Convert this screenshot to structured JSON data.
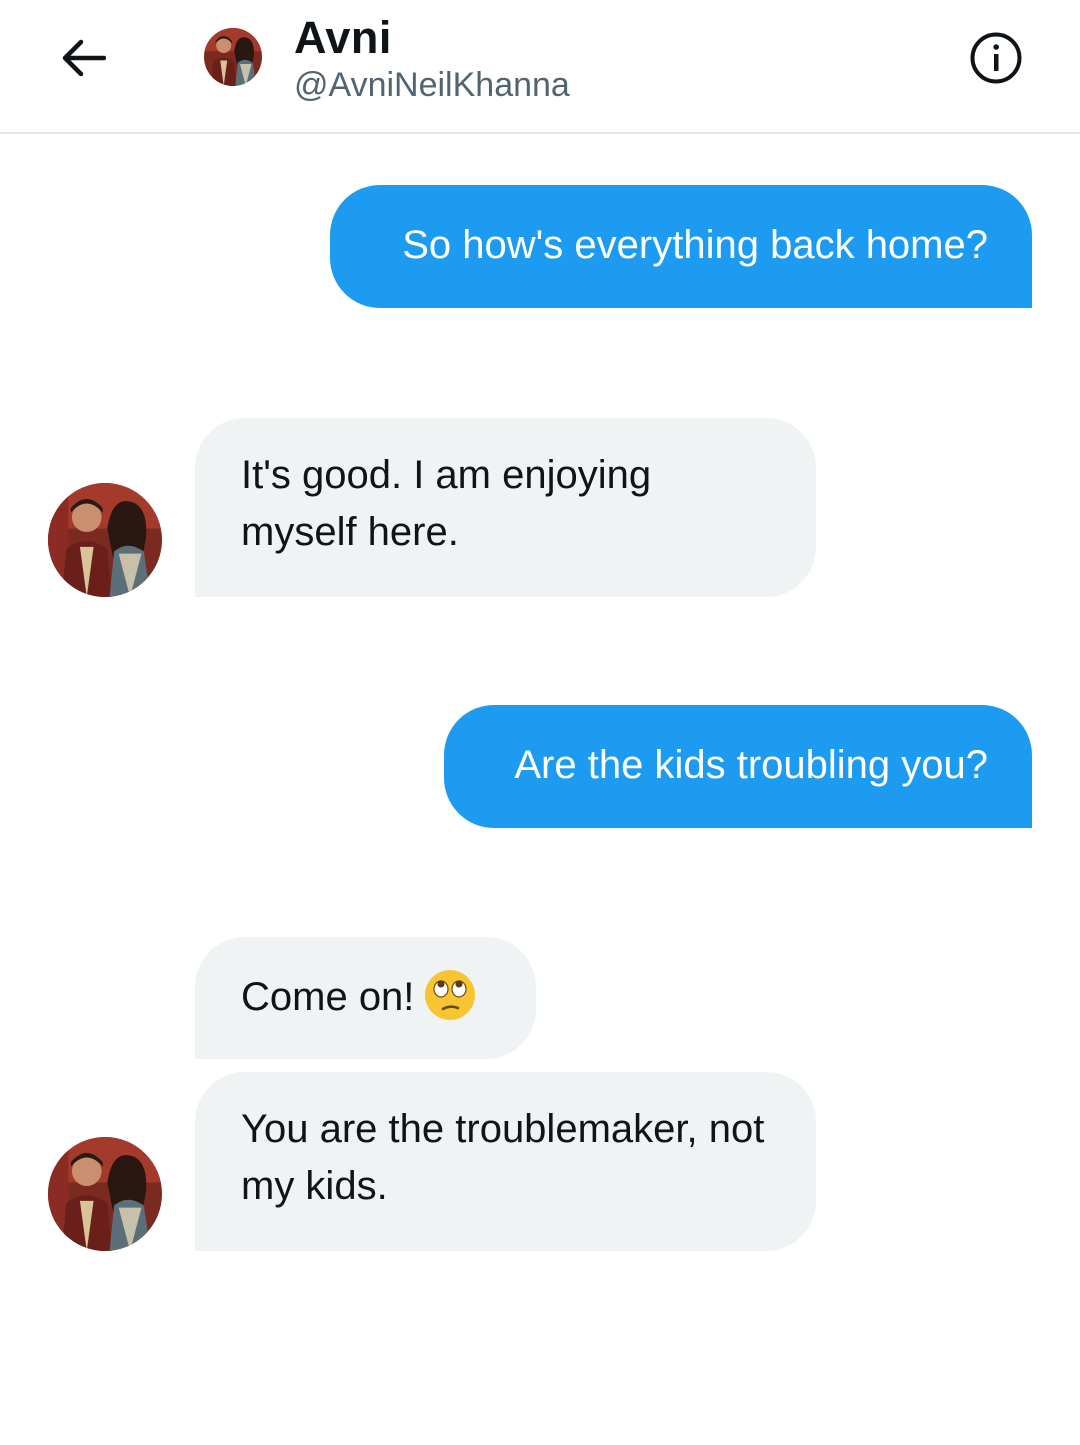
{
  "header": {
    "name": "Avni",
    "handle": "@AvniNeilKhanna",
    "back_icon": "arrow-left-icon",
    "info_icon": "info-icon"
  },
  "messages": [
    {
      "direction": "sent",
      "text": "So how's everything back home?"
    },
    {
      "direction": "received",
      "text": "It's good. I am enjoying myself here."
    },
    {
      "direction": "sent",
      "text": "Are the kids troubling you?"
    },
    {
      "direction": "received",
      "text": "Come on!",
      "emoji": "eye-roll-emoji"
    },
    {
      "direction": "received",
      "text": "You are the troublemaker, not my kids."
    }
  ],
  "colors": {
    "sent_bubble": "#1d9bf0",
    "received_bubble": "#eff3f4",
    "text_primary": "#0f1419",
    "text_secondary": "#536471"
  }
}
